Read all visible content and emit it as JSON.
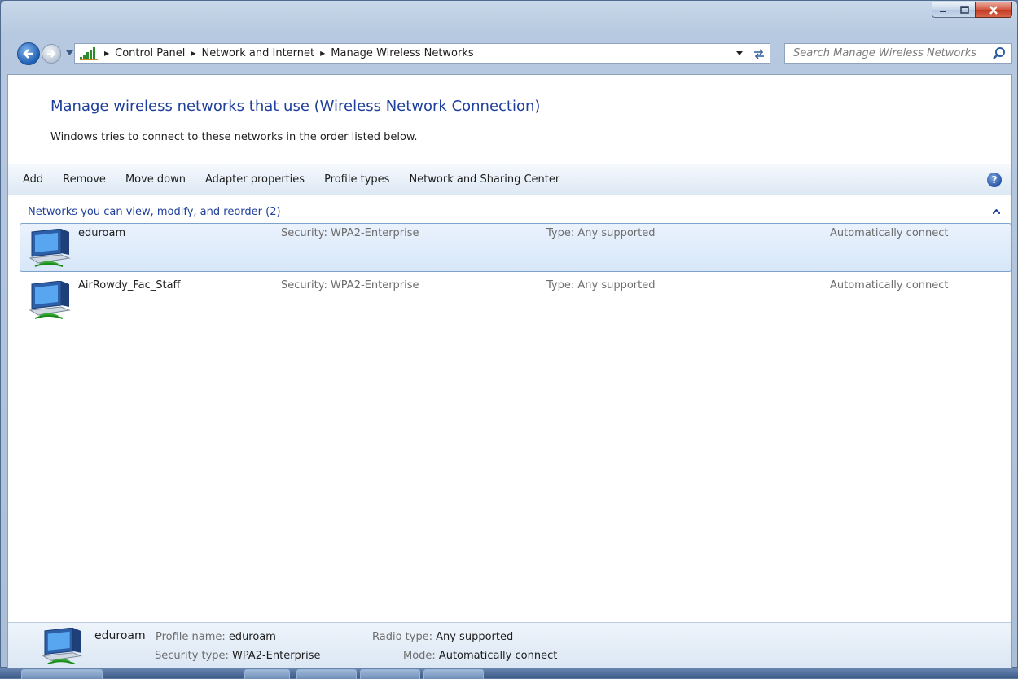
{
  "window": {
    "caption_buttons": {
      "minimize": "minimize-icon",
      "maximize": "maximize-icon",
      "close": "close-icon"
    }
  },
  "navbar": {
    "breadcrumbs": [
      "Control Panel",
      "Network and Internet",
      "Manage Wireless Networks"
    ],
    "search_placeholder": "Search Manage Wireless Networks"
  },
  "page": {
    "title": "Manage wireless networks that use (Wireless Network Connection)",
    "description": "Windows tries to connect to these networks in the order listed below."
  },
  "toolbar": {
    "items": [
      "Add",
      "Remove",
      "Move down",
      "Adapter properties",
      "Profile types",
      "Network and Sharing Center"
    ]
  },
  "group": {
    "title": "Networks you can view, modify, and reorder (2)"
  },
  "networks": [
    {
      "name": "eduroam",
      "security": "Security:  WPA2-Enterprise",
      "type": "Type:  Any supported",
      "connect": "Automatically connect",
      "selected": true
    },
    {
      "name": "AirRowdy_Fac_Staff",
      "security": "Security:  WPA2-Enterprise",
      "type": "Type:  Any supported",
      "connect": "Automatically connect",
      "selected": false
    }
  ],
  "details": {
    "name": "eduroam",
    "profile_name_label": "Profile name:",
    "profile_name": "eduroam",
    "security_type_label": "Security type:",
    "security_type": "WPA2-Enterprise",
    "radio_type_label": "Radio type:",
    "radio_type": "Any supported",
    "mode_label": "Mode:",
    "mode": "Automatically connect"
  },
  "colors": {
    "link_blue": "#1e3f9c",
    "selection_border": "#7da2ce"
  }
}
